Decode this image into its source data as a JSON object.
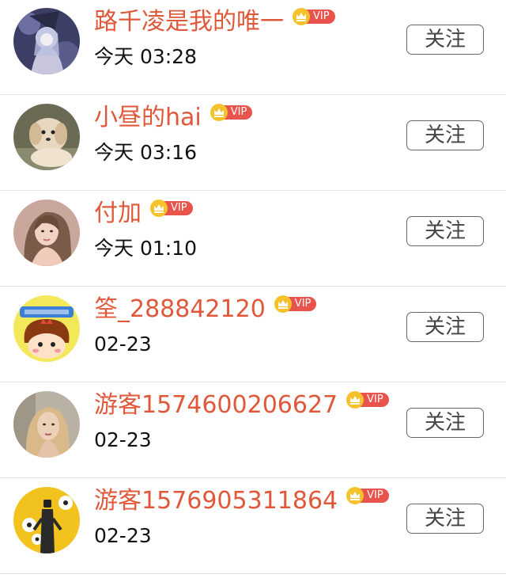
{
  "follow_label": "关注",
  "vip_label": "VIP",
  "colors": {
    "username": "#e0583a",
    "vip_badge": "#e8534b",
    "vip_crown": "#f5c22c",
    "divider": "#e3e3e3"
  },
  "users": [
    {
      "name": "路千凌是我的唯一",
      "time": "今天 03:28",
      "avatar": "anime-girl-avatar"
    },
    {
      "name": "小昼的hai",
      "time": "今天 03:16",
      "avatar": "dog-avatar"
    },
    {
      "name": "付加",
      "time": "今天 01:10",
      "avatar": "woman-portrait-avatar"
    },
    {
      "name": "筌_288842120",
      "time": "02-23",
      "avatar": "cartoon-avatar"
    },
    {
      "name": "游客1574600206627",
      "time": "02-23",
      "avatar": "blonde-woman-avatar"
    },
    {
      "name": "游客1576905311864",
      "time": "02-23",
      "avatar": "illustration-avatar"
    }
  ]
}
